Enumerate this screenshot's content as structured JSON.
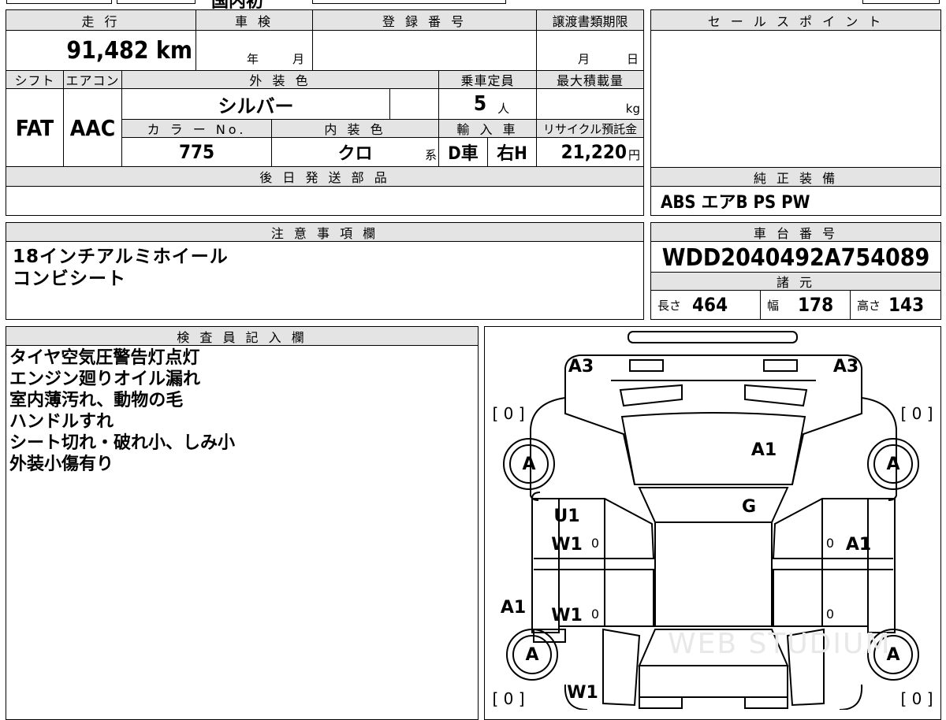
{
  "top_fragment": "国内初",
  "mileage": {
    "header": "走 行",
    "value": "91,482 km"
  },
  "inspection": {
    "header": "車 検",
    "year_label": "年",
    "month_label": "月"
  },
  "registration": {
    "header": "登 録 番 号",
    "value": ""
  },
  "transfer_deadline": {
    "header": "譲渡書類期限",
    "month_label": "月",
    "day_label": "日"
  },
  "sales_point": {
    "header": "セ ー ル ス ポ イ ン ト",
    "value": ""
  },
  "shift": {
    "header": "シフト",
    "value": "FAT"
  },
  "aircon": {
    "header": "エアコン",
    "value": "AAC"
  },
  "exterior_color": {
    "header": "外 装 色",
    "value": "シルバー"
  },
  "capacity": {
    "header": "乗車定員",
    "value": "5",
    "unit": "人"
  },
  "max_load": {
    "header": "最大積載量",
    "unit": "kg"
  },
  "color_no": {
    "header": "カ ラ ー No.",
    "value": "775"
  },
  "interior_color": {
    "header": "内 装 色",
    "value": "クロ",
    "suffix": "系"
  },
  "import": {
    "header": "輸 入 車",
    "drive": "D車",
    "handle": "右H"
  },
  "recycle": {
    "header": "リサイクル預託金",
    "value": "21,220",
    "unit": "円"
  },
  "later_parts": {
    "header": "後 日 発 送 部 品",
    "value": ""
  },
  "equipment": {
    "header": "純 正 装 備",
    "value": "ABS エアB PS PW"
  },
  "notes": {
    "header": "注 意 事 項 欄",
    "lines": [
      "18インチアルミホイール",
      "コンビシート"
    ]
  },
  "chassis": {
    "header": "車 台 番 号",
    "value": "WDD2040492A754089"
  },
  "specs": {
    "header": "諸 元",
    "length_label": "長さ",
    "length": "464",
    "width_label": "幅",
    "width": "178",
    "height_label": "高さ",
    "height": "143"
  },
  "inspector": {
    "header": "検 査 員 記 入 欄",
    "lines": [
      "タイヤ空気圧警告灯点灯",
      "エンジン廻りオイル漏れ",
      "室内薄汚れ、動物の毛",
      "ハンドルすれ",
      "シート切れ・破れ小、しみ小",
      "外装小傷有り"
    ]
  },
  "diagram": {
    "codes": {
      "front_left": "A3",
      "front_right": "A3",
      "hood": "A1",
      "windshield": "G",
      "front_door_left_1": "U1",
      "front_door_left_2": "W1",
      "front_door_right": "A1",
      "fender_left": "A1",
      "rear_door_left": "W1",
      "rear_quarter_left": "W1",
      "tire_fl": "A",
      "tire_fr": "A",
      "tire_rl": "A",
      "tire_rr": "A"
    },
    "zero_small": "0",
    "bracket_fl": "[ 0 ]",
    "bracket_fr": "[ 0 ]",
    "bracket_rl": "[ 0 ]",
    "bracket_rr": "[ 0 ]",
    "watermark": "WEB STUDIUM"
  }
}
